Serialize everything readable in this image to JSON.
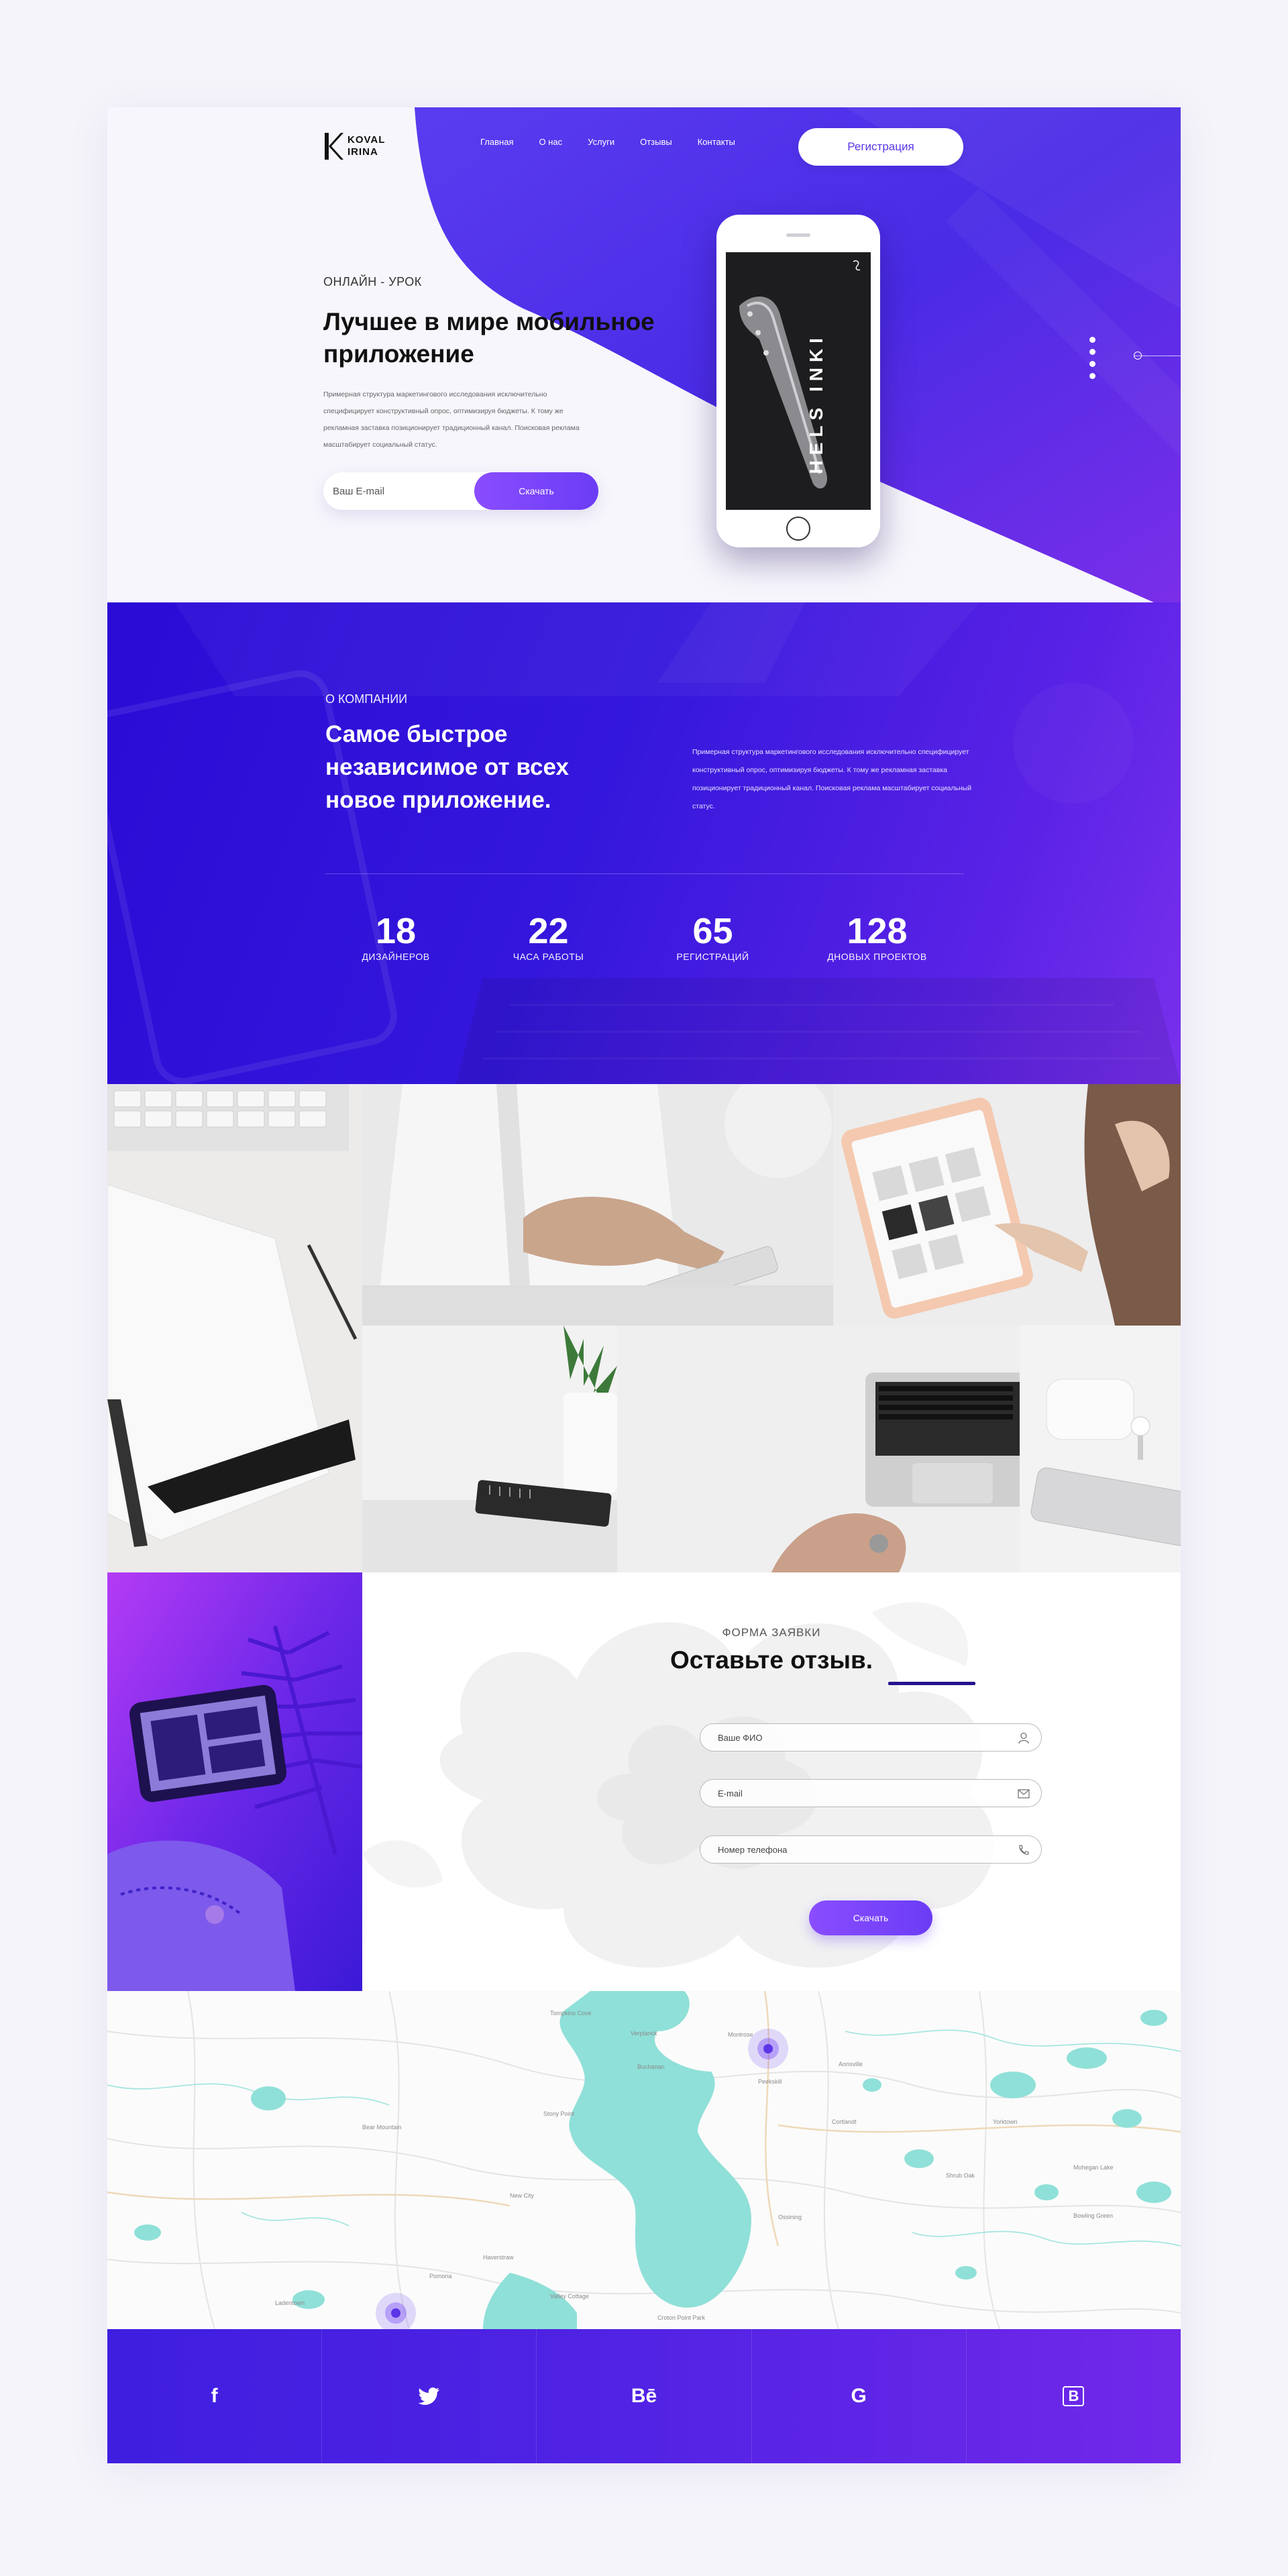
{
  "brand": {
    "line1": "KOVAL",
    "line2": "IRINA"
  },
  "nav": {
    "items": [
      "Главная",
      "О нас",
      "Услуги",
      "Отзывы",
      "Контакты"
    ],
    "register": "Регистрация"
  },
  "hero": {
    "kicker": "ОНЛАЙН - УРОК",
    "title": "Лучшее в мире мобильное приложение",
    "text": "Примерная структура маркетингового исследования исключительно специфицирует конструктивный опрос, оптимизируя бюджеты. К тому же рекламная заставка позиционирует традиционный канал. Поисковая реклама масштабирует социальный статус.",
    "email_placeholder": "Ваш E-mail",
    "button": "Скачать",
    "phone_screen_text": "HELS INKI"
  },
  "about": {
    "kicker": "О КОМПАНИИ",
    "title": "Самое быстрое независимое от всех новое приложение.",
    "text": "Примерная структура маркетингового исследования исключительно специфицирует конструктивный опрос, оптимизируя бюджеты. К тому же рекламная заставка позиционирует традиционный канал. Поисковая реклама масштабирует социальный статус.",
    "stats": [
      {
        "value": "18",
        "label": "ДИЗАЙНЕРОВ"
      },
      {
        "value": "22",
        "label": "ЧАСА РАБОТЫ"
      },
      {
        "value": "65",
        "label": "РЕГИСТРАЦИЙ"
      },
      {
        "value": "128",
        "label": "ДНОВЫХ ПРОЕКТОВ"
      }
    ]
  },
  "form": {
    "kicker": "ФОРМА ЗАЯВКИ",
    "title": "Оставьте отзыв.",
    "name_placeholder": "Ваше ФИО",
    "email_placeholder": "E-mail",
    "phone_placeholder": "Номер телефона",
    "button": "Скачать"
  },
  "map": {
    "labels": [
      "Tompkins Cove",
      "Verplanck",
      "Montrose",
      "Buchanan",
      "Peekskill",
      "Annsville",
      "Bear Mountain",
      "Cortlandt",
      "Stony Point",
      "Croton Point Park",
      "Haverstraw",
      "Ossining",
      "Mohegan Lake",
      "Yorktown",
      "Shrub Oak",
      "Bowling Green",
      "Ladentown",
      "Pomona",
      "New City",
      "Valley Cottage"
    ]
  },
  "footer": {
    "socials": [
      {
        "icon": "facebook-icon",
        "glyph": "f"
      },
      {
        "icon": "twitter-icon",
        "glyph": ""
      },
      {
        "icon": "behance-icon",
        "glyph": "Bē"
      },
      {
        "icon": "google-icon",
        "glyph": "G"
      },
      {
        "icon": "vk-icon",
        "glyph": "В"
      }
    ]
  },
  "colors": {
    "accent": "#5b35e6",
    "gradient_start": "#2a0bd6",
    "gradient_end": "#7830ec",
    "map_water": "#8fe0d8"
  }
}
